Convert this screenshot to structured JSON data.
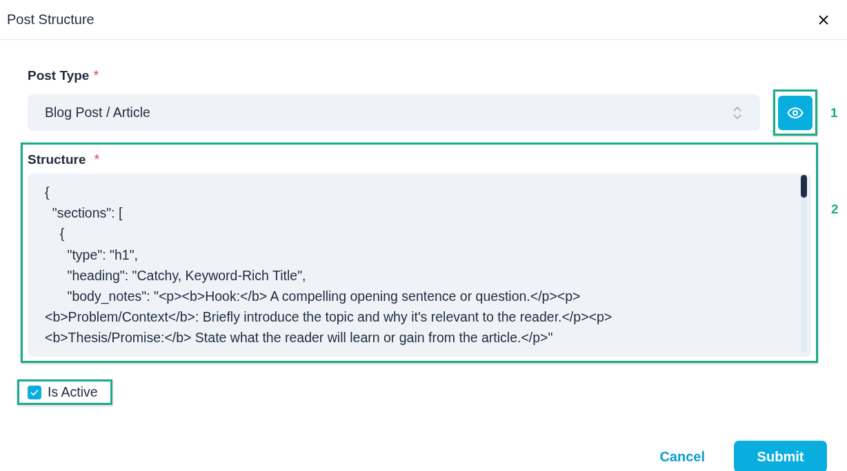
{
  "dialog": {
    "title": "Post Structure"
  },
  "post_type": {
    "label": "Post Type",
    "required_mark": "*",
    "value": "Blog Post / Article"
  },
  "callouts": [
    {
      "number": "1"
    },
    {
      "number": "2"
    }
  ],
  "structure": {
    "label": "Structure",
    "required_mark": "*",
    "lines": [
      "{",
      "  \"sections\": [",
      "    {",
      "      \"type\": \"h1\",",
      "      \"heading\": \"Catchy, Keyword-Rich Title\",",
      "      \"body_notes\": \"<p><b>Hook:</b> A compelling opening sentence or question.</p><p>",
      "<b>Problem/Context</b>: Briefly introduce the topic and why it's relevant to the reader.</p><p>",
      "<b>Thesis/Promise:</b> State what the reader will learn or gain from the article.</p>\""
    ]
  },
  "is_active": {
    "label": "Is Active",
    "checked": true
  },
  "buttons": [
    {
      "label": "Cancel",
      "kind": "text"
    },
    {
      "label": "Submit",
      "kind": "primary"
    }
  ]
}
